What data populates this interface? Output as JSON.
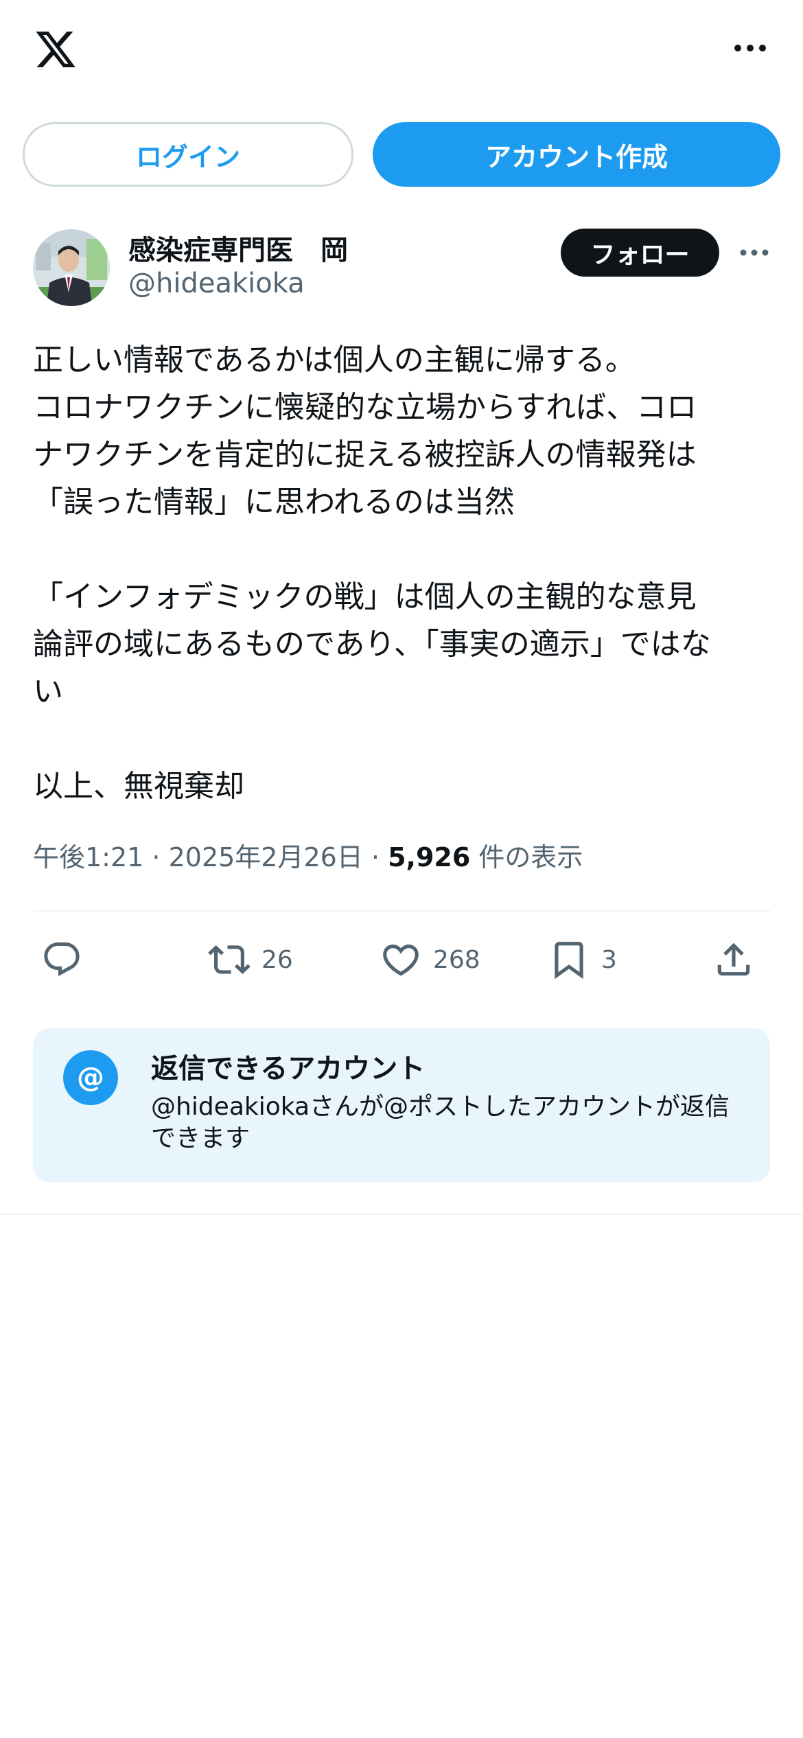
{
  "top_bar": {
    "logo_icon": "x-logo-icon",
    "more_icon": "more-horizontal-icon"
  },
  "auth": {
    "login_label": "ログイン",
    "signup_label": "アカウント作成"
  },
  "post": {
    "author": {
      "display_name": "感染症専門医　岡",
      "handle": "@hideakioka",
      "avatar_icon": "avatar"
    },
    "follow_label": "フォロー",
    "more_icon": "more-horizontal-icon",
    "text": {
      "line_1": "正しい情報であるかは個人の主観に帰する。",
      "line_2": "コロナワクチンに懐疑的な立場からすれば、コロ",
      "line_3": "ナワクチンを肯定的に捉える被控訴人の情報発は",
      "line_4": "「誤った情報」に思われるのは当然",
      "line_5": "「インフォデミックの戦」は個人の主観的な意見",
      "line_6": "論評の域にあるものであり、「事実の適示」ではな",
      "line_7": "い",
      "line_8": "以上、無視棄却"
    },
    "meta": {
      "time": "午後1:21",
      "separator_1": " · ",
      "date": "2025年2月26日",
      "separator_2": " · ",
      "views_count": "5,926",
      "views_label": " 件の表示"
    },
    "actions": {
      "reply_icon": "reply-icon",
      "repost_icon": "repost-icon",
      "repost_count": "26",
      "like_icon": "heart-icon",
      "like_count": "268",
      "bookmark_icon": "bookmark-icon",
      "bookmark_count": "3",
      "share_icon": "share-icon"
    }
  },
  "reply_settings": {
    "icon_glyph": "@",
    "title": "返信できるアカウント",
    "description": "@hideakiokaさんが@ポストしたアカウントが返信できます"
  },
  "colors": {
    "accent": "#1d9bf0",
    "text_primary": "#0f1419",
    "text_secondary": "#536471",
    "reply_box_bg": "#e8f5fd",
    "border": "#cfd9de"
  }
}
